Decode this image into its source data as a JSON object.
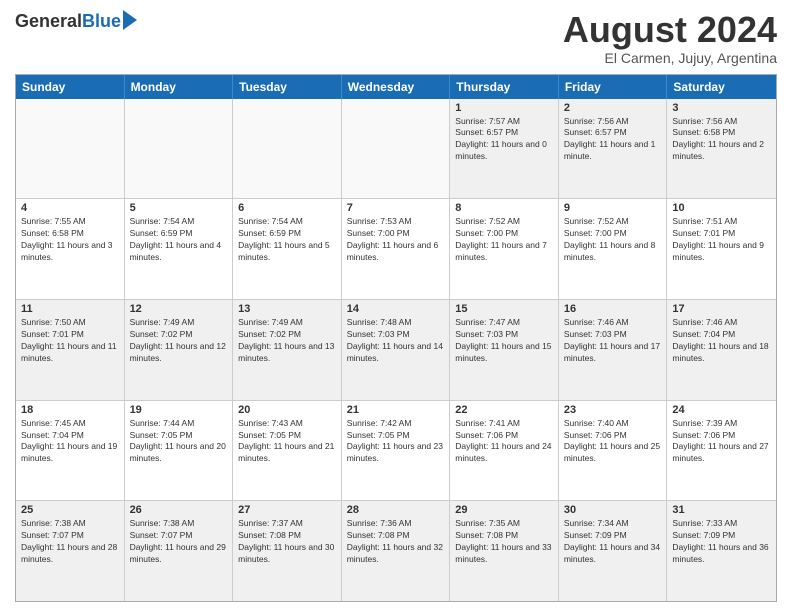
{
  "header": {
    "logo_general": "General",
    "logo_blue": "Blue",
    "month_title": "August 2024",
    "location": "El Carmen, Jujuy, Argentina"
  },
  "weekdays": [
    "Sunday",
    "Monday",
    "Tuesday",
    "Wednesday",
    "Thursday",
    "Friday",
    "Saturday"
  ],
  "rows": [
    [
      {
        "day": "",
        "text": ""
      },
      {
        "day": "",
        "text": ""
      },
      {
        "day": "",
        "text": ""
      },
      {
        "day": "",
        "text": ""
      },
      {
        "day": "1",
        "text": "Sunrise: 7:57 AM\nSunset: 6:57 PM\nDaylight: 11 hours and 0 minutes."
      },
      {
        "day": "2",
        "text": "Sunrise: 7:56 AM\nSunset: 6:57 PM\nDaylight: 11 hours and 1 minute."
      },
      {
        "day": "3",
        "text": "Sunrise: 7:56 AM\nSunset: 6:58 PM\nDaylight: 11 hours and 2 minutes."
      }
    ],
    [
      {
        "day": "4",
        "text": "Sunrise: 7:55 AM\nSunset: 6:58 PM\nDaylight: 11 hours and 3 minutes."
      },
      {
        "day": "5",
        "text": "Sunrise: 7:54 AM\nSunset: 6:59 PM\nDaylight: 11 hours and 4 minutes."
      },
      {
        "day": "6",
        "text": "Sunrise: 7:54 AM\nSunset: 6:59 PM\nDaylight: 11 hours and 5 minutes."
      },
      {
        "day": "7",
        "text": "Sunrise: 7:53 AM\nSunset: 7:00 PM\nDaylight: 11 hours and 6 minutes."
      },
      {
        "day": "8",
        "text": "Sunrise: 7:52 AM\nSunset: 7:00 PM\nDaylight: 11 hours and 7 minutes."
      },
      {
        "day": "9",
        "text": "Sunrise: 7:52 AM\nSunset: 7:00 PM\nDaylight: 11 hours and 8 minutes."
      },
      {
        "day": "10",
        "text": "Sunrise: 7:51 AM\nSunset: 7:01 PM\nDaylight: 11 hours and 9 minutes."
      }
    ],
    [
      {
        "day": "11",
        "text": "Sunrise: 7:50 AM\nSunset: 7:01 PM\nDaylight: 11 hours and 11 minutes."
      },
      {
        "day": "12",
        "text": "Sunrise: 7:49 AM\nSunset: 7:02 PM\nDaylight: 11 hours and 12 minutes."
      },
      {
        "day": "13",
        "text": "Sunrise: 7:49 AM\nSunset: 7:02 PM\nDaylight: 11 hours and 13 minutes."
      },
      {
        "day": "14",
        "text": "Sunrise: 7:48 AM\nSunset: 7:03 PM\nDaylight: 11 hours and 14 minutes."
      },
      {
        "day": "15",
        "text": "Sunrise: 7:47 AM\nSunset: 7:03 PM\nDaylight: 11 hours and 15 minutes."
      },
      {
        "day": "16",
        "text": "Sunrise: 7:46 AM\nSunset: 7:03 PM\nDaylight: 11 hours and 17 minutes."
      },
      {
        "day": "17",
        "text": "Sunrise: 7:46 AM\nSunset: 7:04 PM\nDaylight: 11 hours and 18 minutes."
      }
    ],
    [
      {
        "day": "18",
        "text": "Sunrise: 7:45 AM\nSunset: 7:04 PM\nDaylight: 11 hours and 19 minutes."
      },
      {
        "day": "19",
        "text": "Sunrise: 7:44 AM\nSunset: 7:05 PM\nDaylight: 11 hours and 20 minutes."
      },
      {
        "day": "20",
        "text": "Sunrise: 7:43 AM\nSunset: 7:05 PM\nDaylight: 11 hours and 21 minutes."
      },
      {
        "day": "21",
        "text": "Sunrise: 7:42 AM\nSunset: 7:05 PM\nDaylight: 11 hours and 23 minutes."
      },
      {
        "day": "22",
        "text": "Sunrise: 7:41 AM\nSunset: 7:06 PM\nDaylight: 11 hours and 24 minutes."
      },
      {
        "day": "23",
        "text": "Sunrise: 7:40 AM\nSunset: 7:06 PM\nDaylight: 11 hours and 25 minutes."
      },
      {
        "day": "24",
        "text": "Sunrise: 7:39 AM\nSunset: 7:06 PM\nDaylight: 11 hours and 27 minutes."
      }
    ],
    [
      {
        "day": "25",
        "text": "Sunrise: 7:38 AM\nSunset: 7:07 PM\nDaylight: 11 hours and 28 minutes."
      },
      {
        "day": "26",
        "text": "Sunrise: 7:38 AM\nSunset: 7:07 PM\nDaylight: 11 hours and 29 minutes."
      },
      {
        "day": "27",
        "text": "Sunrise: 7:37 AM\nSunset: 7:08 PM\nDaylight: 11 hours and 30 minutes."
      },
      {
        "day": "28",
        "text": "Sunrise: 7:36 AM\nSunset: 7:08 PM\nDaylight: 11 hours and 32 minutes."
      },
      {
        "day": "29",
        "text": "Sunrise: 7:35 AM\nSunset: 7:08 PM\nDaylight: 11 hours and 33 minutes."
      },
      {
        "day": "30",
        "text": "Sunrise: 7:34 AM\nSunset: 7:09 PM\nDaylight: 11 hours and 34 minutes."
      },
      {
        "day": "31",
        "text": "Sunrise: 7:33 AM\nSunset: 7:09 PM\nDaylight: 11 hours and 36 minutes."
      }
    ]
  ]
}
